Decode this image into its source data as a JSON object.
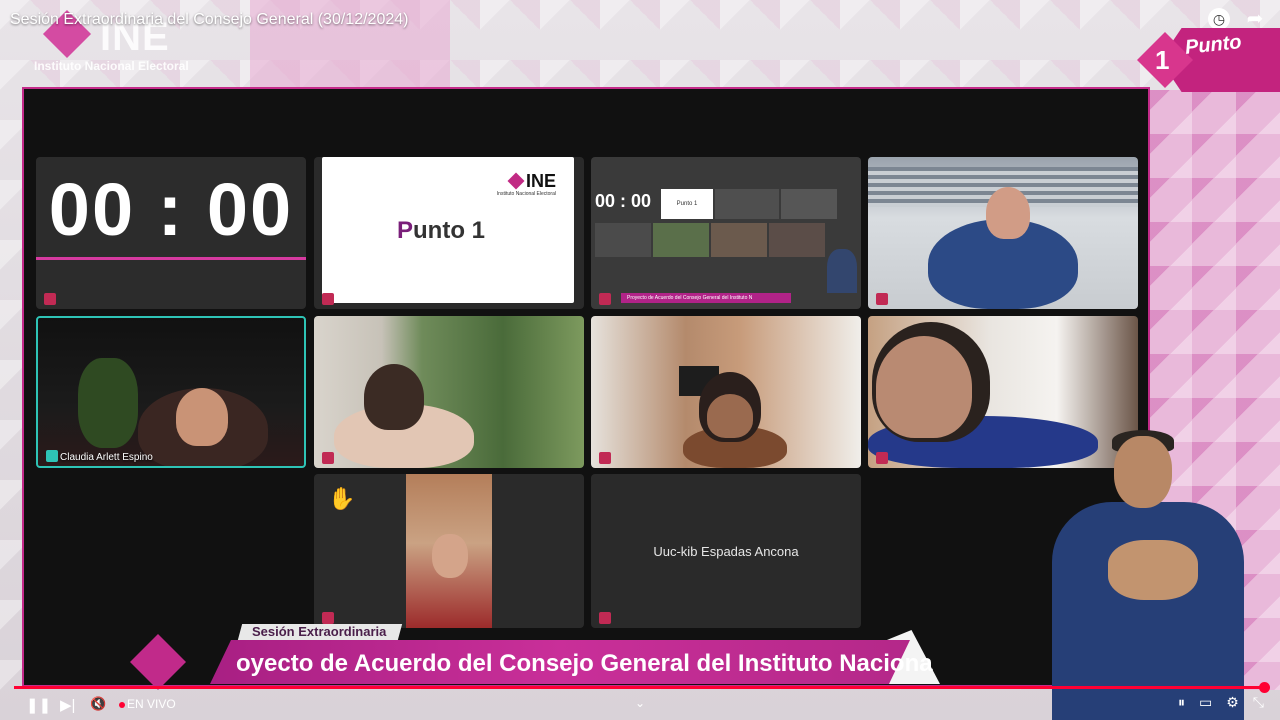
{
  "video": {
    "title": "Sesión Extraordinaria del Consejo General (30/12/2024)"
  },
  "branding": {
    "logo_letters": "INE",
    "logo_subtitle": "Instituto Nacional Electoral"
  },
  "badge": {
    "number": "1",
    "text": "Punto"
  },
  "grid": {
    "timer": "00 : 00",
    "slide": {
      "logo_letters": "INE",
      "logo_subtitle": "Instituto Nacional Electoral",
      "title_first": "P",
      "title_rest": "unto 1"
    },
    "mini": {
      "timer": "00 : 00",
      "punto": "Punto 1",
      "caption": "Proyecto de Acuerdo del Consejo General del Instituto N"
    },
    "participant_active_name": "Claudia Arlett Espino",
    "participant_raise_hand": "✋",
    "participant_no_video_name": "Uuc-kib Espadas Ancona"
  },
  "lower_third": {
    "tag": "Sesión Extraordinaria",
    "headline": "oyecto de Acuerdo del Consejo General del Instituto Naciona"
  },
  "player": {
    "play_pause": "❚❚",
    "next": "▶|",
    "mute": "🔇",
    "live_label": "EN VIVO",
    "chevron": "⌄",
    "autoplay": "⏸",
    "subtitles": "▭",
    "settings": "⚙",
    "exit_fullscreen": "⤡",
    "progress": 1.0
  },
  "colors": {
    "accent_magenta": "#c42b8a",
    "progress_red": "#ff0033",
    "active_speaker": "#2ec4b6"
  },
  "icons": {
    "clock": "clock-icon",
    "share": "share-icon"
  }
}
